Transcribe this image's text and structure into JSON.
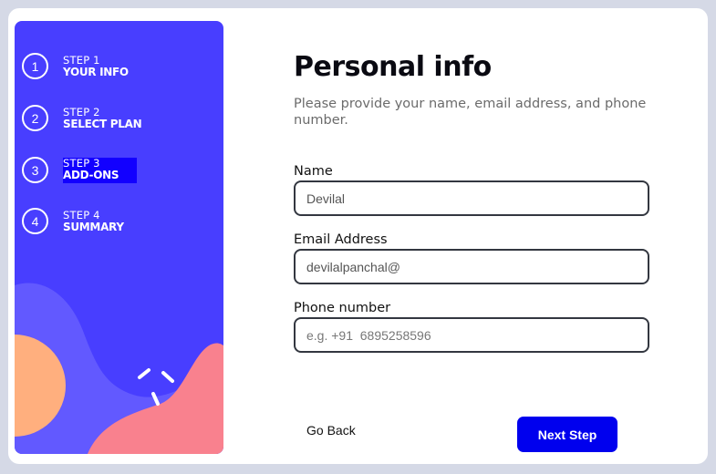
{
  "sidebar": {
    "steps": [
      {
        "number": "1",
        "label": "STEP 1",
        "title": "YOUR INFO"
      },
      {
        "number": "2",
        "label": "STEP 2",
        "title": "SELECT PLAN"
      },
      {
        "number": "3",
        "label": "STEP 3",
        "title": "ADD-ONS"
      },
      {
        "number": "4",
        "label": "STEP 4",
        "title": "SUMMARY"
      }
    ],
    "selected_step": 3,
    "colors": {
      "background": "#483eff",
      "blob_purple": "#6259ff",
      "blob_orange": "#ffaf7e",
      "blob_pink": "#f9818e",
      "highlight": "#1200ff"
    }
  },
  "main": {
    "title": "Personal info",
    "subtitle": "Please provide your name, email address, and phone number.",
    "fields": {
      "name": {
        "label": "Name",
        "value": "Devilal",
        "placeholder": ""
      },
      "email": {
        "label": "Email Address",
        "value": "devilalpanchal@",
        "placeholder": ""
      },
      "phone": {
        "label": "Phone number",
        "value": "",
        "placeholder": "e.g. +91  6895258596"
      }
    }
  },
  "footer": {
    "back_label": "Go Back",
    "next_label": "Next Step",
    "accent": "#0000ee"
  }
}
